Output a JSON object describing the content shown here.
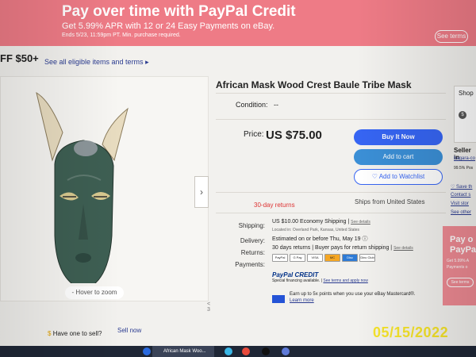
{
  "banner": {
    "title": "Pay over time with PayPal Credit",
    "subtitle": "Get 5.99% APR with 12 or 24 Easy Payments on eBay.",
    "fineprint": "Ends 5/23, 11:59pm PT. Min. purchase required.",
    "button": "See terms",
    "color": "#ee7b86"
  },
  "promo": {
    "text": "FF $50+",
    "link": "See all eligible items and terms"
  },
  "gallery": {
    "zoom_hint": "- Hover to zoom",
    "next_icon": "chevron-right-icon",
    "dot": "< 3"
  },
  "item": {
    "title": "African Mask Wood Crest Baule Tribe Mask",
    "condition_label": "Condition:",
    "condition_value": "--",
    "price_label": "Price:",
    "price_value": "US $75.00"
  },
  "actions": {
    "buy": "Buy It Now",
    "cart": "Add to cart",
    "watch": "♡ Add to Watchlist"
  },
  "highlights": {
    "returns": "30-day returns",
    "ships": "Ships from United States"
  },
  "details": {
    "shipping_label": "Shipping:",
    "shipping_value": "US $10.00 Economy Shipping |",
    "shipping_link": "See details",
    "shipping_location": "Located in: Overland Park, Kansas, United States",
    "delivery_label": "Delivery:",
    "delivery_value": "Estimated on or before Thu, May 19",
    "returns_label": "Returns:",
    "returns_value": "30 days returns | Buyer pays for return shipping |",
    "returns_link": "See details",
    "payments_label": "Payments:",
    "payment_cards": [
      "PayPal",
      "G Pay",
      "VISA",
      "MC",
      "Disc",
      "Dinc Club"
    ]
  },
  "credit": {
    "logo": "PayPal CREDIT",
    "sub": "Special financing available. |",
    "sub_link": "See terms and apply now",
    "earn": "Earn up to 5x points when you use your eBay Mastercard®.",
    "earn_link": "Learn more"
  },
  "side": {
    "shop_label": "Shop",
    "seller_label": "Seller in",
    "seller_name": "bagara-co",
    "seller_pct": "99.5% Pos",
    "links": [
      "Save th",
      "Contact s",
      "Visit stor",
      "See other"
    ],
    "pp_title": "Pay o PayPa",
    "pp_sub": "Get 5.99% A Payments o",
    "pp_btn": "See terms"
  },
  "sell": {
    "text": "Have one to sell?",
    "link": "Sell now"
  },
  "taskbar": {
    "active": "African Mask Woo..."
  },
  "date_stamp": "05/15/2022"
}
